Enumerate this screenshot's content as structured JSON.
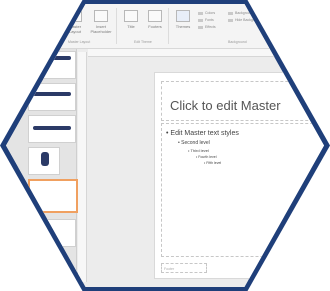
{
  "ribbon": {
    "buttons": [
      {
        "label": "Master Layout"
      },
      {
        "label": "Insert Placeholder"
      },
      {
        "label": "Title"
      },
      {
        "label": "Footers"
      },
      {
        "label": "Themes"
      }
    ],
    "options": [
      "Colors",
      "Fonts",
      "Effects",
      "Background Styles",
      "Hide Background Graphics"
    ],
    "groups": [
      "Master Layout",
      "Edit Theme",
      "Background"
    ]
  },
  "slide": {
    "title": "Click to edit Master",
    "body_levels": [
      "Edit Master text styles",
      "Second level",
      "Third level",
      "Fourth level",
      "Fifth level"
    ],
    "footer": "Footer"
  },
  "colors": {
    "hex_border": "#1f3f7a",
    "selected_thumb": "#f0a060"
  }
}
